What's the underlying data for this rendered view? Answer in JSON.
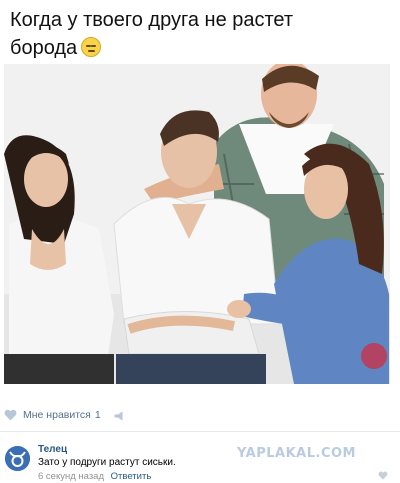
{
  "post": {
    "text": "Когда у твоего друга не растет борода",
    "emoji_icon": "pensive-face-icon"
  },
  "photo": {
    "description_icon": "stock-photo-group-comforting-man",
    "watermark_text": "YAPLAKAL"
  },
  "likes": {
    "label": "Мне нравится",
    "count": "1",
    "heart_icon": "heart-icon",
    "share_icon": "megaphone-icon"
  },
  "comment": {
    "author": "Телец",
    "text": "Зато у подруги растут сиськи.",
    "time": "6 секунд назад",
    "reply_label": "Ответить",
    "avatar_icon": "taurus-avatar-icon",
    "heart_icon": "heart-icon"
  },
  "site": {
    "logo_text": "YAPLAKAL.COM"
  },
  "colors": {
    "link": "#2a5885",
    "meta": "#939393",
    "like": "#54708c",
    "logo": "#b9cbe0"
  }
}
